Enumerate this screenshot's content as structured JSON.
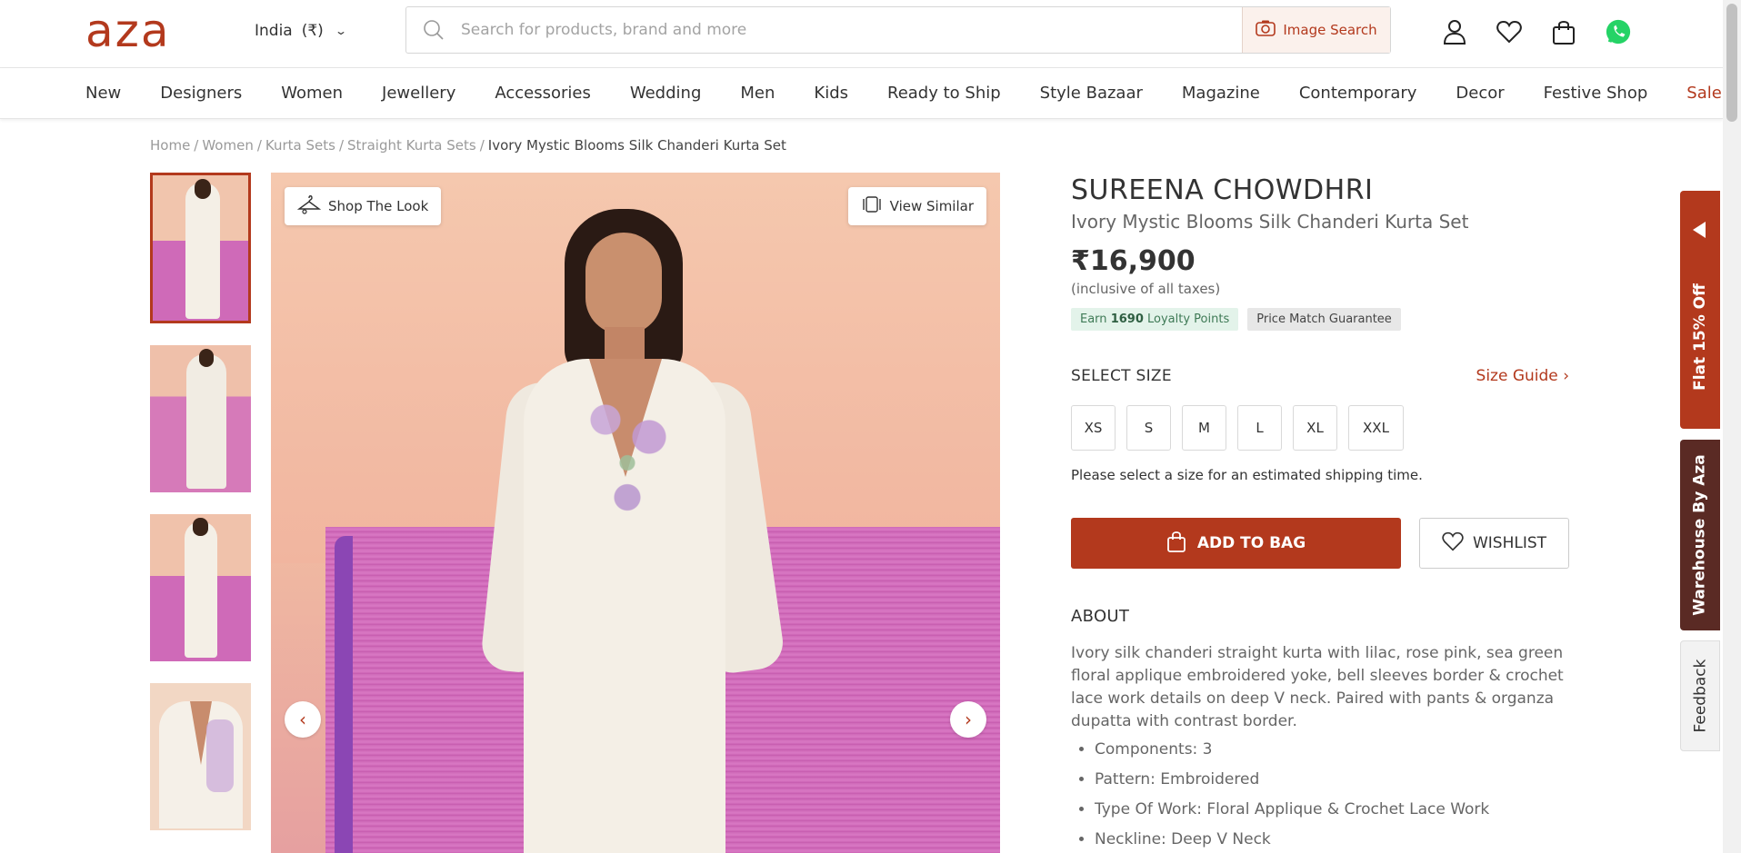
{
  "header": {
    "logo": "aza",
    "country": "India",
    "currency": "(₹)",
    "search_placeholder": "Search for products, brand and more",
    "image_search_label": "Image Search",
    "icons": [
      "user-icon",
      "heart-icon",
      "bag-icon",
      "whatsapp-icon"
    ]
  },
  "nav": {
    "items": [
      "New",
      "Designers",
      "Women",
      "Jewellery",
      "Accessories",
      "Wedding",
      "Men",
      "Kids",
      "Ready to Ship",
      "Style Bazaar",
      "Magazine",
      "Contemporary",
      "Decor",
      "Festive Shop",
      "Sale"
    ]
  },
  "breadcrumb": {
    "items": [
      "Home",
      "Women",
      "Kurta Sets",
      "Straight Kurta Sets"
    ],
    "current": "Ivory Mystic Blooms Silk Chanderi Kurta Set"
  },
  "gallery": {
    "shop_the_look": "Shop The Look",
    "view_similar": "View Similar"
  },
  "product": {
    "designer": "SUREENA CHOWDHRI",
    "name": "Ivory Mystic Blooms Silk Chanderi Kurta Set",
    "price": "₹16,900",
    "taxes_note": "(inclusive of all taxes)",
    "loyalty_prefix": "Earn",
    "loyalty_points": "1690",
    "loyalty_suffix": "Loyalty Points",
    "price_match": "Price Match Guarantee",
    "select_size_label": "SELECT SIZE",
    "size_guide_label": "Size Guide",
    "sizes": [
      "XS",
      "S",
      "M",
      "L",
      "XL",
      "XXL"
    ],
    "shipping_note": "Please select a size for an estimated shipping time.",
    "add_to_bag": "ADD TO BAG",
    "wishlist": "WISHLIST",
    "about_heading": "ABOUT",
    "about_text": "Ivory silk chanderi straight kurta with lilac, rose pink, sea green floral applique embroidered yoke, bell sleeves border & crochet lace work details on deep V neck. Paired with pants & organza dupatta with contrast border.",
    "specs": [
      "Components: 3",
      "Pattern: Embroidered",
      "Type Of Work: Floral Applique & Crochet Lace Work",
      "Neckline: Deep V Neck"
    ]
  },
  "side_tabs": {
    "offer": "Flat 15% Off",
    "warehouse": "Warehouse By Aza",
    "feedback": "Feedback"
  },
  "colors": {
    "brand": "#b3391d",
    "warehouse_tab": "#5a2a24",
    "loyalty_bg": "#e3f3ea"
  }
}
